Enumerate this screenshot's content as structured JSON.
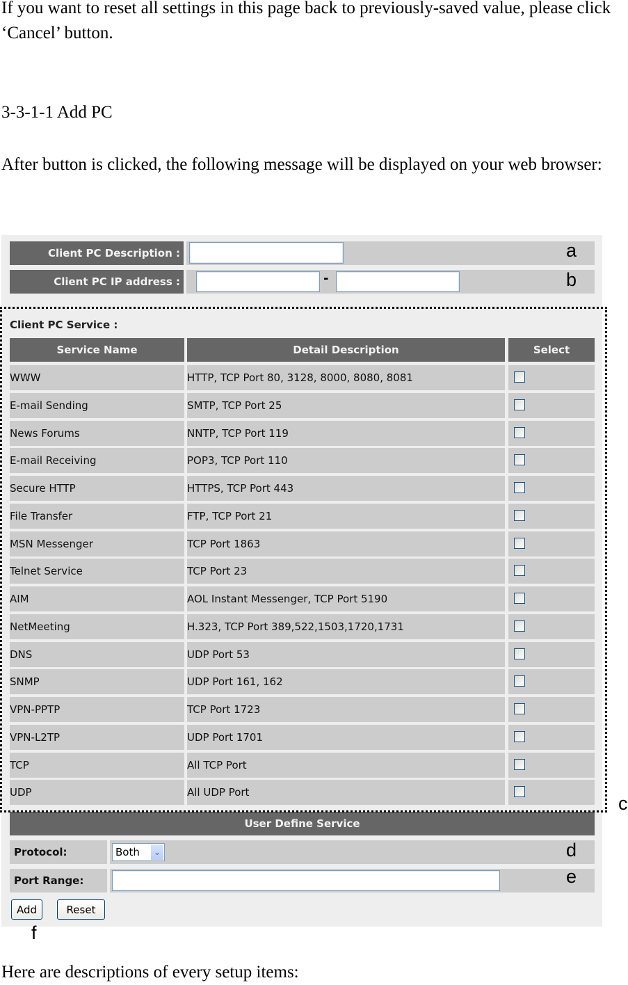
{
  "document": {
    "intro_paragraph": "If you want to reset all settings in this page back to previously-saved value, please click ‘Cancel’ button.",
    "section_heading": "3-3-1-1 Add PC",
    "after_click_paragraph": "After button is clicked, the following message will be displayed on your web browser:",
    "closing_paragraph": "Here are descriptions of every setup items:"
  },
  "form": {
    "client_pc_description": {
      "label": "Client PC Description :",
      "value": "",
      "marker": "a"
    },
    "client_pc_ip": {
      "label": "Client PC IP address :",
      "start_value": "",
      "end_value": "",
      "separator": "-",
      "marker": "b"
    },
    "service_section": {
      "title": "Client PC Service :",
      "marker": "c",
      "columns": [
        "Service Name",
        "Detail Description",
        "Select"
      ],
      "rows": [
        {
          "name": "WWW",
          "description": "HTTP, TCP Port 80, 3128, 8000, 8080, 8081",
          "checked": false
        },
        {
          "name": "E-mail Sending",
          "description": "SMTP, TCP Port 25",
          "checked": false
        },
        {
          "name": "News Forums",
          "description": "NNTP, TCP Port 119",
          "checked": false
        },
        {
          "name": "E-mail Receiving",
          "description": "POP3, TCP Port 110",
          "checked": false
        },
        {
          "name": "Secure HTTP",
          "description": "HTTPS, TCP Port 443",
          "checked": false
        },
        {
          "name": "File Transfer",
          "description": "FTP, TCP Port 21",
          "checked": false
        },
        {
          "name": "MSN Messenger",
          "description": "TCP Port 1863",
          "checked": false
        },
        {
          "name": "Telnet Service",
          "description": "TCP Port 23",
          "checked": false
        },
        {
          "name": "AIM",
          "description": "AOL Instant Messenger, TCP Port 5190",
          "checked": false
        },
        {
          "name": "NetMeeting",
          "description": "H.323, TCP Port 389,522,1503,1720,1731",
          "checked": false
        },
        {
          "name": "DNS",
          "description": "UDP Port 53",
          "checked": false
        },
        {
          "name": "SNMP",
          "description": "UDP Port 161, 162",
          "checked": false
        },
        {
          "name": "VPN-PPTP",
          "description": "TCP Port 1723",
          "checked": false
        },
        {
          "name": "VPN-L2TP",
          "description": "UDP Port 1701",
          "checked": false
        },
        {
          "name": "TCP",
          "description": "All TCP Port",
          "checked": false
        },
        {
          "name": "UDP",
          "description": "All UDP Port",
          "checked": false
        }
      ]
    },
    "user_define_service": {
      "title": "User Define Service",
      "protocol": {
        "label": "Protocol:",
        "selected": "Both",
        "marker": "d"
      },
      "port_range": {
        "label": "Port Range:",
        "value": "",
        "marker": "e"
      },
      "buttons": {
        "add": "Add",
        "reset": "Reset",
        "marker": "f"
      }
    }
  },
  "colors": {
    "header_bg": "#666666",
    "cell_bg": "#cccccc",
    "panel_bg": "#eeeeee",
    "input_border": "#7f9db9",
    "checkbox_border": "#1c5180"
  },
  "icons": {
    "select_arrow": "chevron-down-icon"
  }
}
